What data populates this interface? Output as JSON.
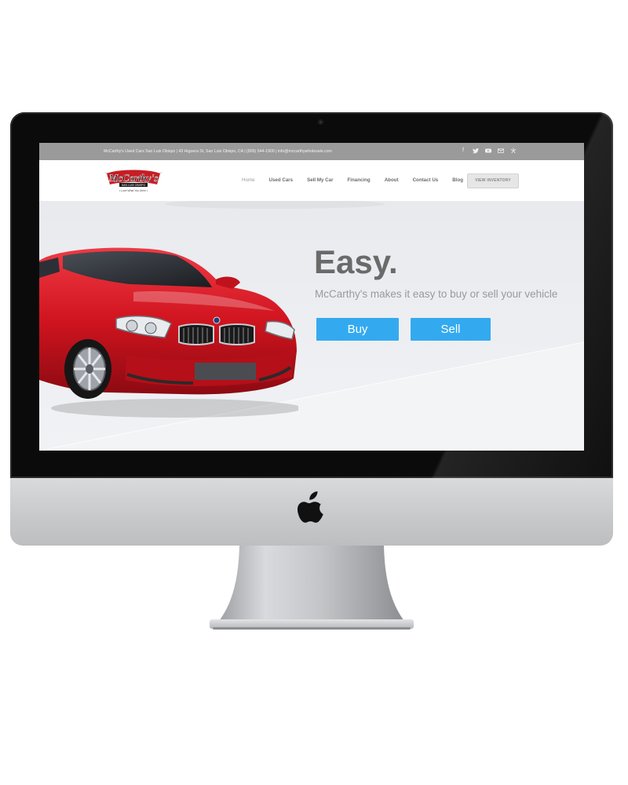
{
  "topbar": {
    "contact": "McCarthy's Used Cars San Luis Obispo | 43 Higuera St, San Luis Obispo, CA | (805) 544-1900  |  info@mccarthywholesale.com",
    "social_icons": [
      "facebook-icon",
      "twitter-icon",
      "youtube-icon",
      "email-icon",
      "yelp-icon"
    ]
  },
  "logo": {
    "brand": "McCarthy's",
    "location": "SAN LUIS OBISPO",
    "tagline": "• Love What You Drive •"
  },
  "nav": {
    "items": [
      {
        "label": "Home",
        "active": true
      },
      {
        "label": "Used Cars"
      },
      {
        "label": "Sell My Car"
      },
      {
        "label": "Financing"
      },
      {
        "label": "About"
      },
      {
        "label": "Contact Us"
      },
      {
        "label": "Blog"
      }
    ],
    "cta": "VIEW INVENTORY"
  },
  "hero": {
    "headline": "Easy.",
    "subline": "McCarthy's makes it easy to buy or sell your vehicle",
    "buy_label": "Buy",
    "sell_label": "Sell"
  },
  "colors": {
    "accent": "#33aaf0",
    "topbar": "#9a9a9a",
    "car_red": "#d0141f"
  }
}
